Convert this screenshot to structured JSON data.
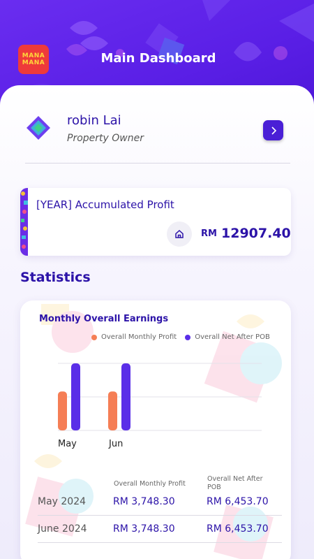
{
  "header": {
    "logo_line1": "MANA",
    "logo_line2": "MANA",
    "title": "Main Dashboard"
  },
  "profile": {
    "name": "robin Lai",
    "role": "Property Owner"
  },
  "profit_card": {
    "title": "[YEAR] Accumulated Profit",
    "currency": "RM",
    "value": "12907.40"
  },
  "statistics": {
    "heading": "Statistics",
    "chart_title": "Monthly Overall Earnings",
    "legend": [
      {
        "label": "Overall Monthly Profit",
        "color": "#f57e55"
      },
      {
        "label": "Overall Net After POB",
        "color": "#5a2ee8"
      }
    ],
    "table": {
      "col1_header": "Overall Monthly Profit",
      "col2_header_line1": "Overall Net After",
      "col2_header_line2": "POB",
      "rows": [
        {
          "month": "May 2024",
          "profit": "RM 3,748.30",
          "net": "RM 6,453.70"
        },
        {
          "month": "June 2024",
          "profit": "RM 3,748.30",
          "net": "RM 6,453.70"
        }
      ]
    }
  },
  "chart_data": {
    "type": "bar",
    "categories": [
      "May",
      "Jun"
    ],
    "series": [
      {
        "name": "Overall Monthly Profit",
        "values": [
          3748.3,
          3748.3
        ],
        "color": "#f57e55"
      },
      {
        "name": "Overall Net After POB",
        "values": [
          6453.7,
          6453.7
        ],
        "color": "#5a2ee8"
      }
    ],
    "title": "Monthly Overall Earnings",
    "xlabel": "",
    "ylabel": "",
    "ylim": [
      0,
      6453.7
    ],
    "grid": true,
    "legend_position": "top-right"
  }
}
